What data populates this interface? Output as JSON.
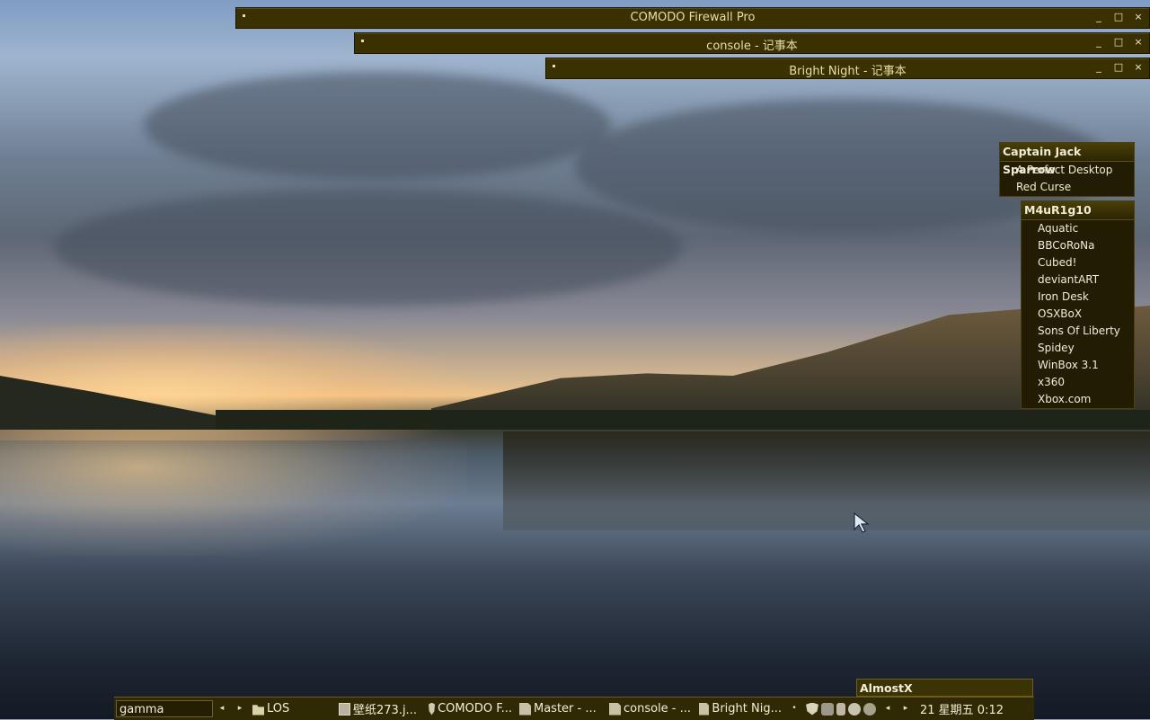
{
  "windows": [
    {
      "title": "COMODO Firewall Pro"
    },
    {
      "title": "console - 记事本"
    },
    {
      "title": "Bright Night - 记事本"
    }
  ],
  "window_controls": {
    "minimize": "_",
    "maximize": "□",
    "close": "×"
  },
  "menus": {
    "captain": {
      "title": "Captain Jack Sparrow",
      "items": [
        "A Perfect Desktop",
        "Red Curse"
      ]
    },
    "m4ur": {
      "title": "M4uR1g10",
      "items": [
        "Aquatic",
        "BBCoRoNa",
        "Cubed!",
        "deviantART",
        "Iron Desk",
        "OSXBoX",
        "Sons Of Liberty",
        "Spidey",
        "WinBox 3.1",
        "x360",
        "Xbox.com"
      ]
    }
  },
  "popup": {
    "label": "AlmostX"
  },
  "taskbar": {
    "field": "gamma",
    "arrow_left": "◂",
    "arrow_right": "▸",
    "tasks": [
      {
        "label": "LOS",
        "icon": "folder-icon"
      },
      {
        "label": "壁纸273.j...",
        "icon": "image-icon"
      },
      {
        "label": "COMODO F...",
        "icon": "shield-icon"
      },
      {
        "label": "Master - ...",
        "icon": "document-icon"
      },
      {
        "label": "console - ...",
        "icon": "document-icon"
      },
      {
        "label": "Bright Nig...",
        "icon": "document-icon"
      }
    ],
    "bullet": "•",
    "clock": "21 星期五 0:12"
  }
}
